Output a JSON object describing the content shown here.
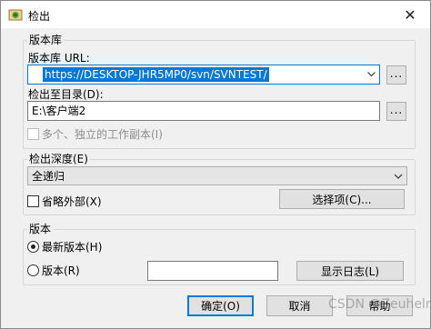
{
  "window": {
    "title": "检出",
    "close_glyph": "✕"
  },
  "repository": {
    "group_title": "版本库",
    "url_label": "版本库 URL:",
    "url_value": "https://DESKTOP-JHR5MP0/svn/SVNTEST/",
    "browse_label": "...",
    "checkout_dir_label": "检出至目录(D):",
    "checkout_dir_value": "E:\\客户端2",
    "browse_dir_label": "...",
    "multi_label": "多个、独立的工作副本(I)"
  },
  "depth": {
    "group_title": "检出深度(E)",
    "selected": "全递归",
    "omit_externals_label": "省略外部(X)",
    "options_button": "选择项(C)..."
  },
  "revision": {
    "group_title": "版本",
    "head_label": "最新版本(H)",
    "revision_label": "版本(R)",
    "revision_value": "",
    "show_log_button": "显示日志(L)"
  },
  "footer": {
    "ok_button": "确定(O)",
    "cancel_button": "取消",
    "help_button": "帮助"
  },
  "watermark": "CSDN @Zeuhelrig"
}
